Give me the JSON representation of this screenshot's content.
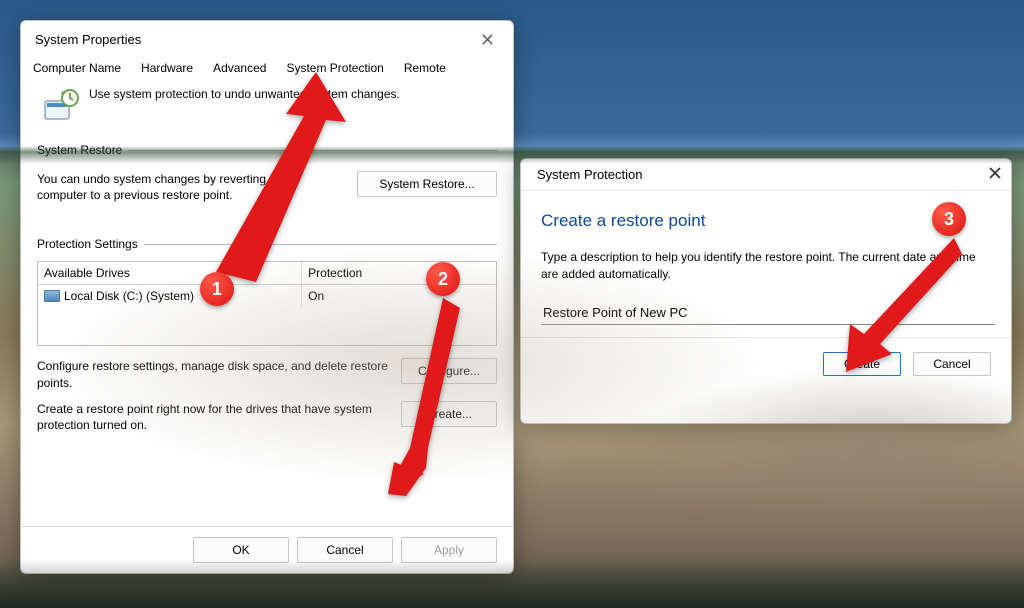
{
  "sysprop": {
    "title": "System Properties",
    "tabs": [
      "Computer Name",
      "Hardware",
      "Advanced",
      "System Protection",
      "Remote"
    ],
    "intro": "Use system protection to undo unwanted system changes.",
    "restore_group": "System Restore",
    "restore_text": "You can undo system changes by reverting your computer to a previous restore point.",
    "restore_btn": "System Restore...",
    "protection_group": "Protection Settings",
    "drives_header": {
      "col1": "Available Drives",
      "col2": "Protection"
    },
    "drives": [
      {
        "name": "Local Disk (C:) (System)",
        "protection": "On"
      }
    ],
    "configure_text": "Configure restore settings, manage disk space, and delete restore points.",
    "configure_btn": "Configure...",
    "create_text": "Create a restore point right now for the drives that have system protection turned on.",
    "create_btn": "Create...",
    "ok": "OK",
    "cancel": "Cancel",
    "apply": "Apply"
  },
  "dlg": {
    "title": "System Protection",
    "heading": "Create a restore point",
    "desc": "Type a description to help you identify the restore point. The current date and time are added automatically.",
    "input_value": "Restore Point of New PC",
    "create": "Create",
    "cancel": "Cancel"
  },
  "badges": {
    "b1": "1",
    "b2": "2",
    "b3": "3"
  }
}
